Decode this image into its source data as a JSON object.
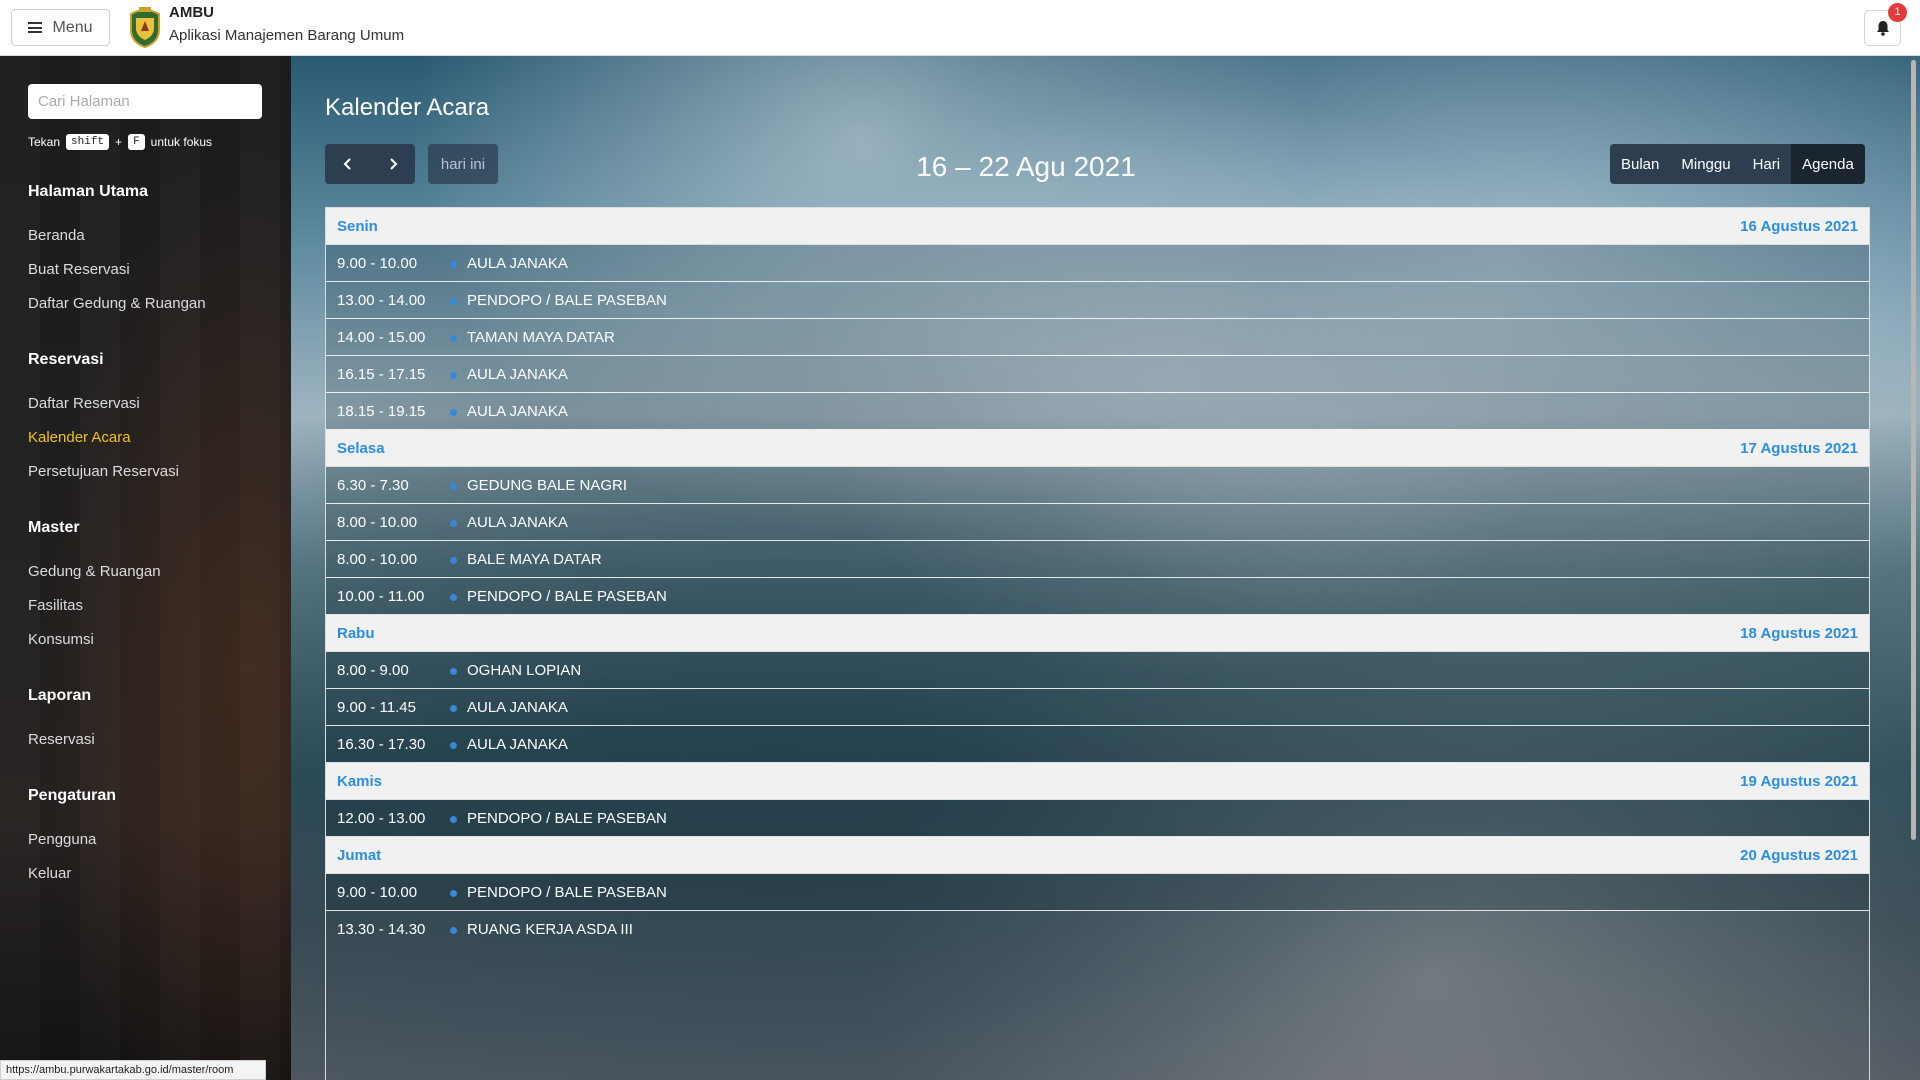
{
  "header": {
    "menu_label": "Menu",
    "app_title": "AMBU",
    "app_subtitle": "Aplikasi Manajemen Barang Umum",
    "notification_count": "1"
  },
  "sidebar": {
    "search_placeholder": "Cari Halaman",
    "hint_prefix": "Tekan",
    "hint_key1": "shift",
    "hint_plus": "+",
    "hint_key2": "F",
    "hint_suffix": "untuk fokus",
    "sections": [
      {
        "title": "Halaman Utama",
        "items": [
          "Beranda",
          "Buat Reservasi",
          "Daftar Gedung & Ruangan"
        ]
      },
      {
        "title": "Reservasi",
        "items": [
          "Daftar Reservasi",
          "Kalender Acara",
          "Persetujuan Reservasi"
        ]
      },
      {
        "title": "Master",
        "items": [
          "Gedung & Ruangan",
          "Fasilitas",
          "Konsumsi"
        ]
      },
      {
        "title": "Laporan",
        "items": [
          "Reservasi"
        ]
      },
      {
        "title": "Pengaturan",
        "items": [
          "Pengguna",
          "Keluar"
        ]
      }
    ],
    "active_item": "Kalender Acara"
  },
  "status_url": "https://ambu.purwakartakab.go.id/master/room",
  "main": {
    "page_title": "Kalender Acara",
    "today_label": "hari ini",
    "range_title": "16 – 22 Agu 2021",
    "views": [
      "Bulan",
      "Minggu",
      "Hari",
      "Agenda"
    ],
    "active_view": "Agenda",
    "accent_color": "#2c8ee0",
    "days": [
      {
        "name": "Senin",
        "date": "16 Agustus 2021",
        "events": [
          {
            "time": "9.00 - 10.00",
            "title": "AULA JANAKA"
          },
          {
            "time": "13.00 - 14.00",
            "title": "PENDOPO / BALE PASEBAN"
          },
          {
            "time": "14.00 - 15.00",
            "title": "TAMAN MAYA DATAR"
          },
          {
            "time": "16.15 - 17.15",
            "title": "AULA JANAKA"
          },
          {
            "time": "18.15 - 19.15",
            "title": "AULA JANAKA"
          }
        ]
      },
      {
        "name": "Selasa",
        "date": "17 Agustus 2021",
        "events": [
          {
            "time": "6.30 - 7.30",
            "title": "GEDUNG BALE NAGRI"
          },
          {
            "time": "8.00 - 10.00",
            "title": "AULA JANAKA"
          },
          {
            "time": "8.00 - 10.00",
            "title": "BALE MAYA DATAR"
          },
          {
            "time": "10.00 - 11.00",
            "title": "PENDOPO / BALE PASEBAN"
          }
        ]
      },
      {
        "name": "Rabu",
        "date": "18 Agustus 2021",
        "events": [
          {
            "time": "8.00 - 9.00",
            "title": "OGHAN LOPIAN"
          },
          {
            "time": "9.00 - 11.45",
            "title": "AULA JANAKA"
          },
          {
            "time": "16.30 - 17.30",
            "title": "AULA JANAKA"
          }
        ]
      },
      {
        "name": "Kamis",
        "date": "19 Agustus 2021",
        "events": [
          {
            "time": "12.00 - 13.00",
            "title": "PENDOPO / BALE PASEBAN"
          }
        ]
      },
      {
        "name": "Jumat",
        "date": "20 Agustus 2021",
        "events": [
          {
            "time": "9.00 - 10.00",
            "title": "PENDOPO / BALE PASEBAN"
          },
          {
            "time": "13.30 - 14.30",
            "title": "RUANG KERJA ASDA III"
          }
        ]
      }
    ]
  }
}
